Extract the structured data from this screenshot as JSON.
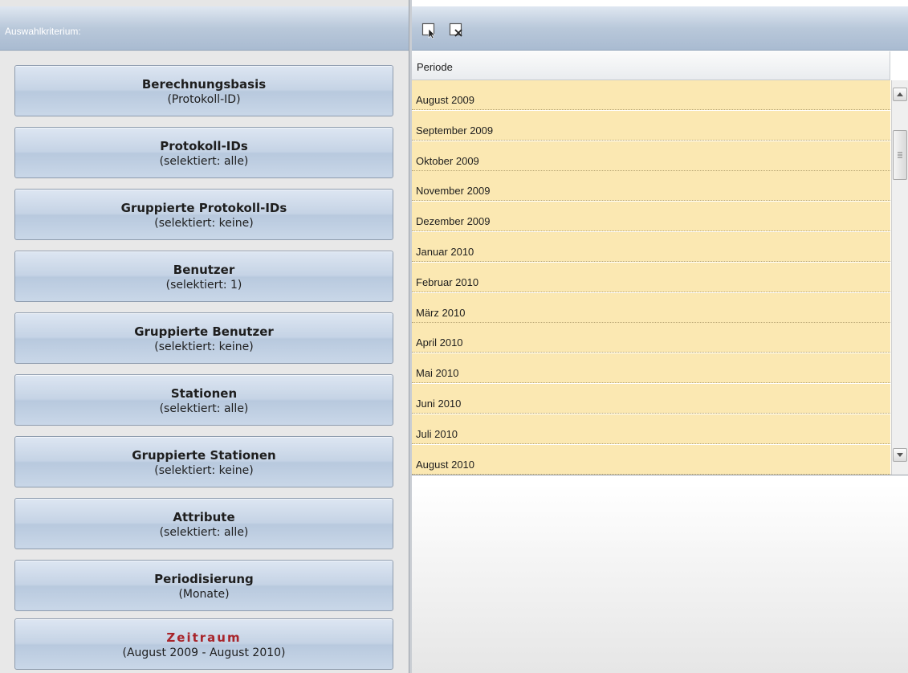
{
  "criteria_panel": {
    "header_label": "Auswahlkriterium:",
    "buttons": [
      {
        "title": "Berechnungsbasis",
        "subtitle": "(Protokoll-ID)"
      },
      {
        "title": "Protokoll-IDs",
        "subtitle": "(selektiert: alle)"
      },
      {
        "title": "Gruppierte Protokoll-IDs",
        "subtitle": "(selektiert: keine)"
      },
      {
        "title": "Benutzer",
        "subtitle": "(selektiert: 1)"
      },
      {
        "title": "Gruppierte Benutzer",
        "subtitle": "(selektiert: keine)"
      },
      {
        "title": "Stationen",
        "subtitle": "(selektiert: alle)"
      },
      {
        "title": "Gruppierte Stationen",
        "subtitle": "(selektiert: keine)"
      },
      {
        "title": "Attribute",
        "subtitle": "(selektiert: alle)"
      },
      {
        "title": "Periodisierung",
        "subtitle": "(Monate)"
      },
      {
        "title": "Zeitraum",
        "subtitle": "(August 2009 - August 2010)",
        "active": true
      }
    ]
  },
  "toolbar": {
    "icons": [
      "select-all-icon",
      "deselect-all-icon"
    ]
  },
  "grid": {
    "column_header": "Periode",
    "rows": [
      "August 2009",
      "September 2009",
      "Oktober 2009",
      "November 2009",
      "Dezember 2009",
      "Januar 2010",
      "Februar 2010",
      "März 2010",
      "April 2010",
      "Mai 2010",
      "Juni 2010",
      "Juli 2010",
      "August 2010"
    ],
    "row_color": "#fbe8b2"
  },
  "colors": {
    "header_gradient_mid": "#b9c8da",
    "active_title": "#a8242a"
  }
}
